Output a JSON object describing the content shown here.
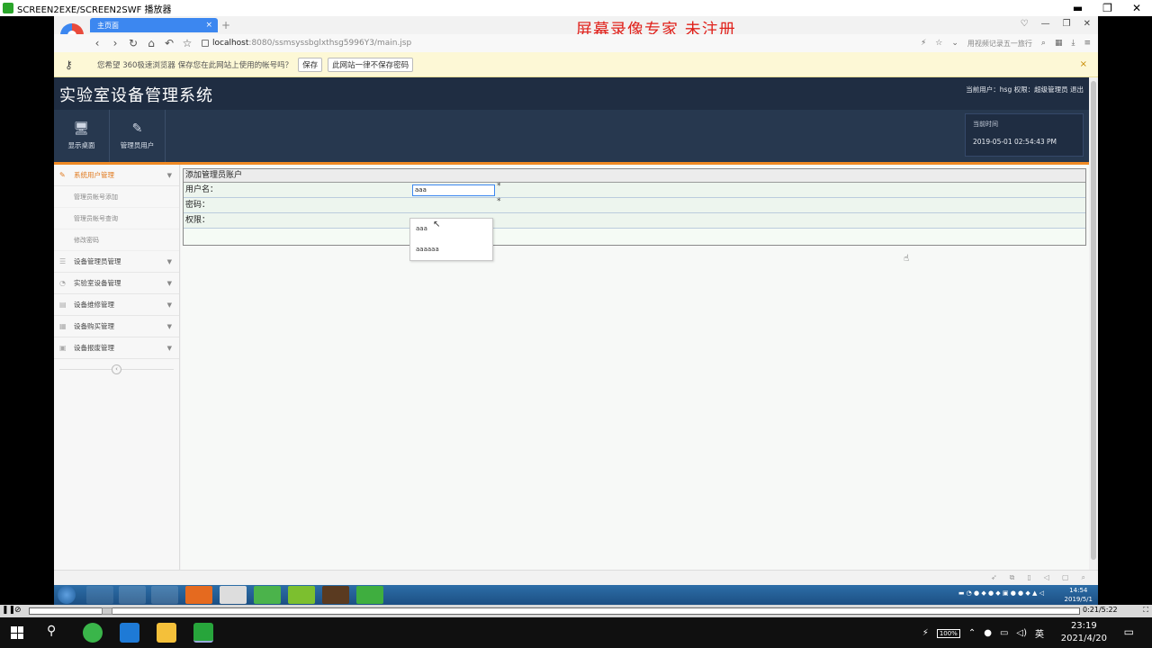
{
  "player": {
    "title": "SCREEN2EXE/SCREEN2SWF 播放器",
    "ctrl_min": "▬",
    "ctrl_restore": "❐",
    "ctrl_close": "✕",
    "time": "0:21/5:22"
  },
  "browser": {
    "tab_label": "主页面",
    "tab_close": "×",
    "new_tab": "+",
    "watermark": "屏幕录像专家  未注册",
    "url_host": "localhost",
    "url_path": ":8080/ssmsyssbglxthsg5996Y3/main.jsp",
    "ad_text": "用视频记录五一旅行",
    "password_bar": {
      "message": "您希望 360极速浏览器 保存您在此网站上使用的帐号吗？",
      "save": "保存",
      "never": "此网站一律不保存密码",
      "close": "×"
    }
  },
  "app": {
    "title": "实验室设备管理系统",
    "user_info": "当前用户：hsg  权限：超级管理员  退出",
    "quick_nav": [
      {
        "label": "显示桌面",
        "icon": "🖥"
      },
      {
        "label": "管理员用户",
        "icon": "✎"
      }
    ],
    "time_label": "当前时间",
    "time_value": "2019-05-01 02:54:43 PM"
  },
  "sidebar": {
    "active_group": "系统用户管理",
    "sub_items": [
      "管理员帐号添加",
      "管理员帐号查询",
      "修改密码"
    ],
    "groups": [
      "设备管理员管理",
      "实验室设备管理",
      "设备维修管理",
      "设备购买管理",
      "设备报废管理"
    ]
  },
  "form": {
    "heading": "添加管理员账户",
    "username_label": "用户名：",
    "password_label": "密码：",
    "role_label": "权限：",
    "username_value": "aaa",
    "required_mark": "*",
    "autocomplete_options": [
      "aaa",
      "aaaaaa"
    ]
  },
  "win7_taskbar": {
    "clock_time": "14:54",
    "clock_date": "2019/5/1"
  },
  "win10_taskbar": {
    "battery": "100%",
    "ime": "英",
    "clock_time": "23:19",
    "clock_date": "2021/4/20"
  }
}
